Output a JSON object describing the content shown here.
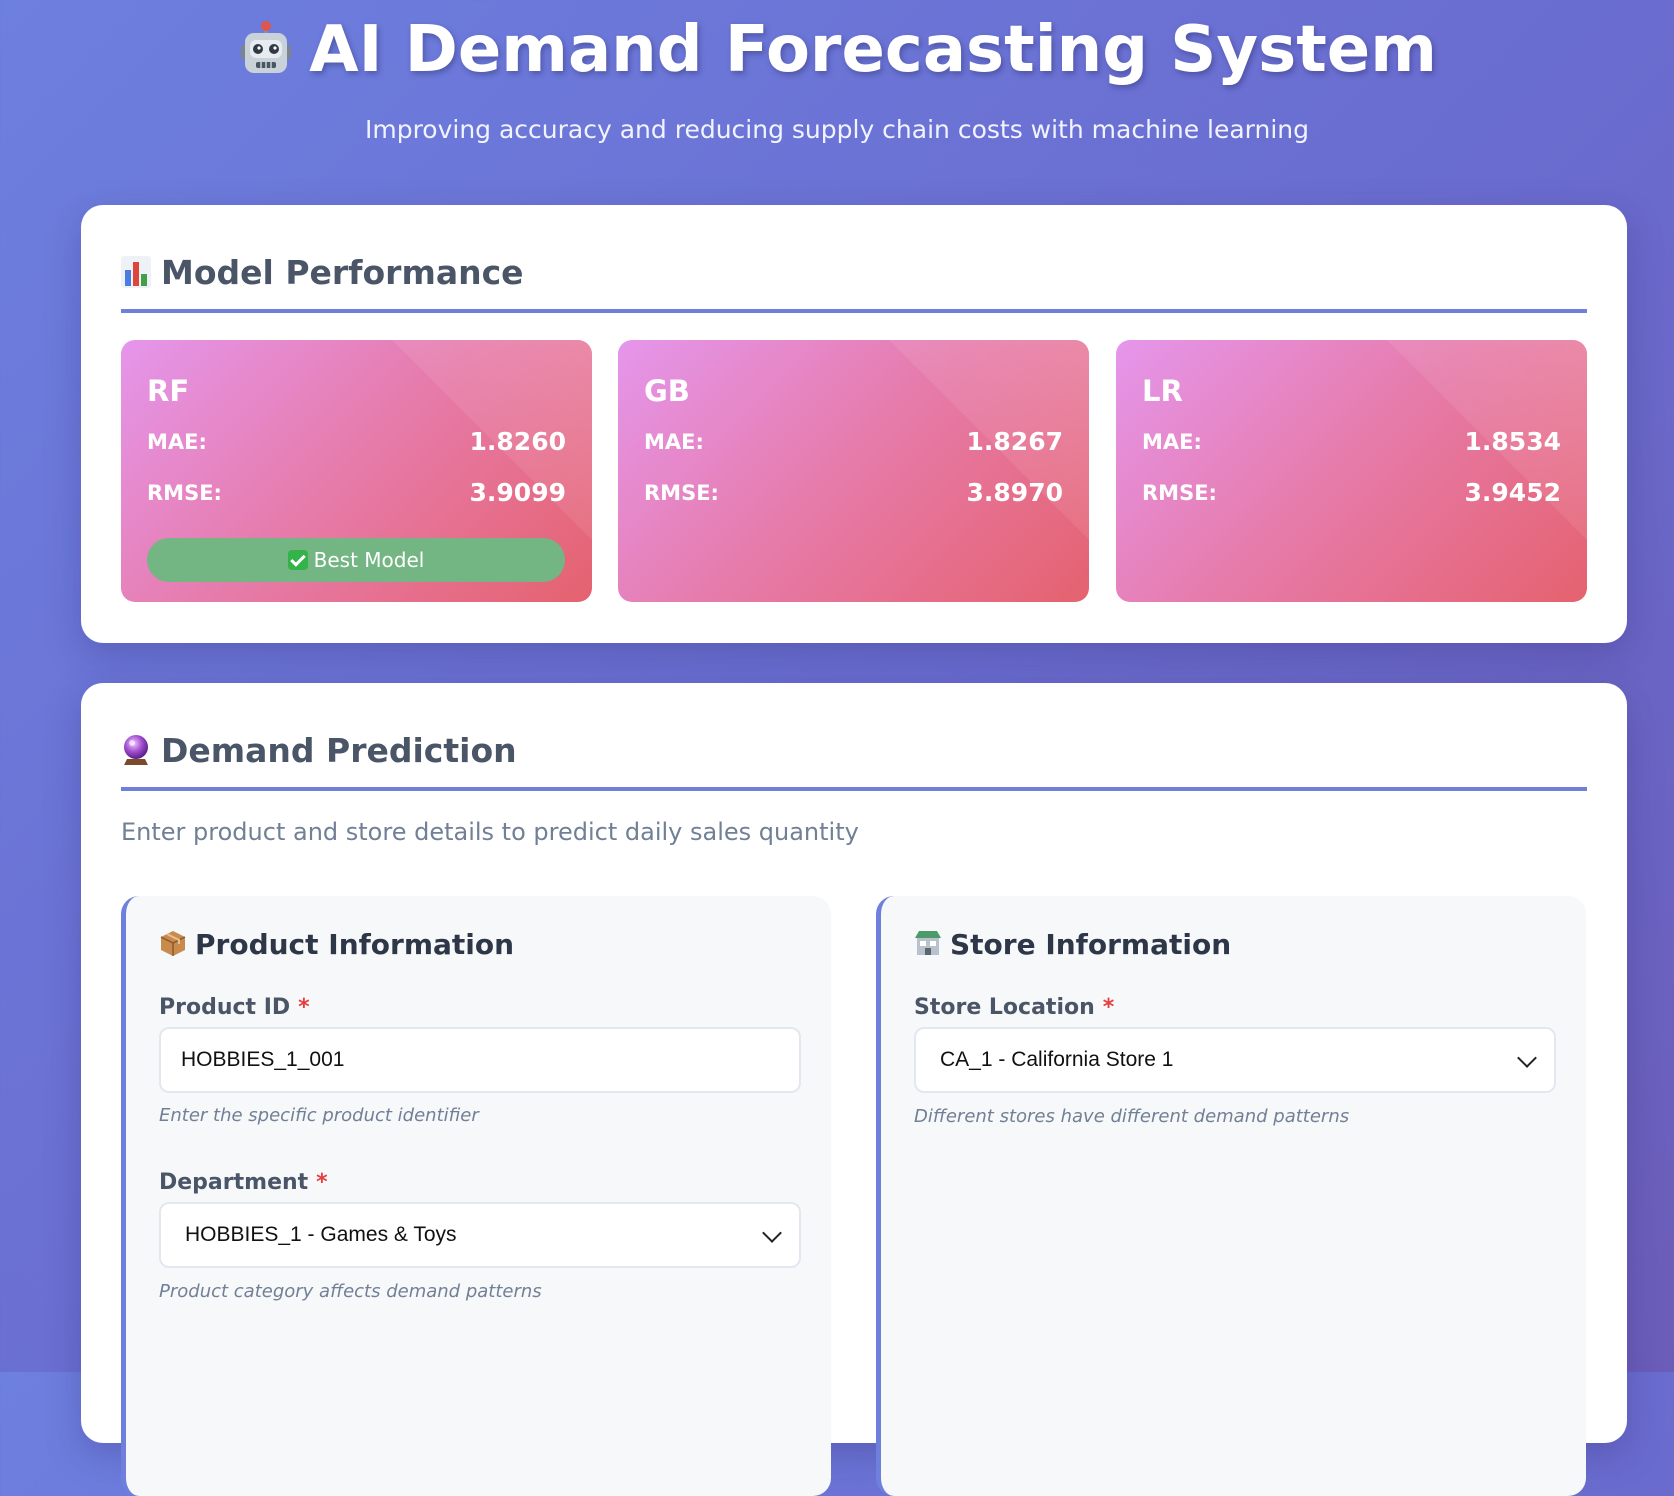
{
  "header": {
    "title": "AI Demand Forecasting System",
    "subtitle": "Improving accuracy and reducing supply chain costs with machine learning",
    "title_icon": "robot-icon"
  },
  "performance": {
    "title": "Model Performance",
    "title_icon": "bar-chart-icon",
    "models": [
      {
        "name": "RF",
        "mae_label": "MAE:",
        "mae": "1.8260",
        "rmse_label": "RMSE:",
        "rmse": "3.9099",
        "badge": "Best Model"
      },
      {
        "name": "GB",
        "mae_label": "MAE:",
        "mae": "1.8267",
        "rmse_label": "RMSE:",
        "rmse": "3.8970"
      },
      {
        "name": "LR",
        "mae_label": "MAE:",
        "mae": "1.8534",
        "rmse_label": "RMSE:",
        "rmse": "3.9452"
      }
    ]
  },
  "prediction": {
    "title": "Demand Prediction",
    "title_icon": "crystal-ball-icon",
    "description": "Enter product and store details to predict daily sales quantity",
    "product": {
      "title": "Product Information",
      "icon": "package-icon",
      "product_id_label": "Product ID",
      "product_id_value": "HOBBIES_1_001",
      "product_id_hint": "Enter the specific product identifier",
      "department_label": "Department",
      "department_value": "HOBBIES_1 - Games & Toys",
      "department_hint": "Product category affects demand patterns"
    },
    "store": {
      "title": "Store Information",
      "icon": "store-icon",
      "location_label": "Store Location",
      "location_value": "CA_1 - California Store 1",
      "location_hint": "Different stores have different demand patterns"
    },
    "required_mark": "*"
  },
  "colors": {
    "accent": "#6f7fdc",
    "card_gradient_start": "#e596ec",
    "card_gradient_end": "#e5626f",
    "badge_green": "#73b583",
    "required_red": "#e53e3e"
  }
}
